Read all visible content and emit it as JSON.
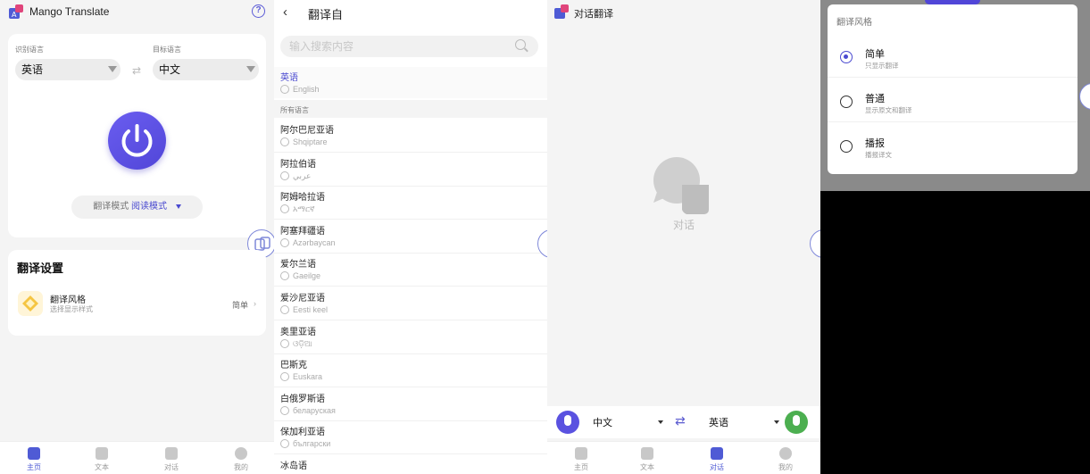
{
  "home": {
    "app_title": "Mango Translate",
    "source_label": "识别语言",
    "source_value": "英语",
    "target_label": "目标语言",
    "target_value": "中文",
    "mode_label": "翻译模式",
    "mode_value": "阅读模式",
    "settings_title": "翻译设置",
    "style_title": "翻译风格",
    "style_subtitle": "选择显示样式",
    "style_value": "简单"
  },
  "nav": [
    "主页",
    "文本",
    "对话",
    "我的"
  ],
  "picker": {
    "title": "翻译自",
    "search_placeholder": "输入搜索内容",
    "selected": {
      "name": "英语",
      "native": "English"
    },
    "all_header": "所有语言",
    "languages": [
      {
        "name": "阿尔巴尼亚语",
        "native": "Shqiptare"
      },
      {
        "name": "阿拉伯语",
        "native": "عربي"
      },
      {
        "name": "阿姆哈拉语",
        "native": "አማርኛ"
      },
      {
        "name": "阿塞拜疆语",
        "native": "Azərbaycan"
      },
      {
        "name": "爱尔兰语",
        "native": "Gaeilge"
      },
      {
        "name": "爱沙尼亚语",
        "native": "Eesti keel"
      },
      {
        "name": "奥里亚语",
        "native": "ଓଡ଼ିଆ"
      },
      {
        "name": "巴斯克",
        "native": "Euskara"
      },
      {
        "name": "白俄罗斯语",
        "native": "беларуская"
      },
      {
        "name": "保加利亚语",
        "native": "български"
      },
      {
        "name": "冰岛语",
        "native": ""
      }
    ]
  },
  "conversation": {
    "title": "对话翻译",
    "empty_label": "对话",
    "left_lang": "中文",
    "right_lang": "英语"
  },
  "style_dialog": {
    "title": "翻译风格",
    "options": [
      {
        "title": "简单",
        "subtitle": "只显示翻译",
        "selected": true
      },
      {
        "title": "普通",
        "subtitle": "显示原文和翻译",
        "selected": false
      },
      {
        "title": "播报",
        "subtitle": "播报译文",
        "selected": false
      }
    ]
  },
  "colors": {
    "accent": "#4f5bd5",
    "mic_left": "#5a52e0",
    "mic_right": "#4caf50"
  }
}
